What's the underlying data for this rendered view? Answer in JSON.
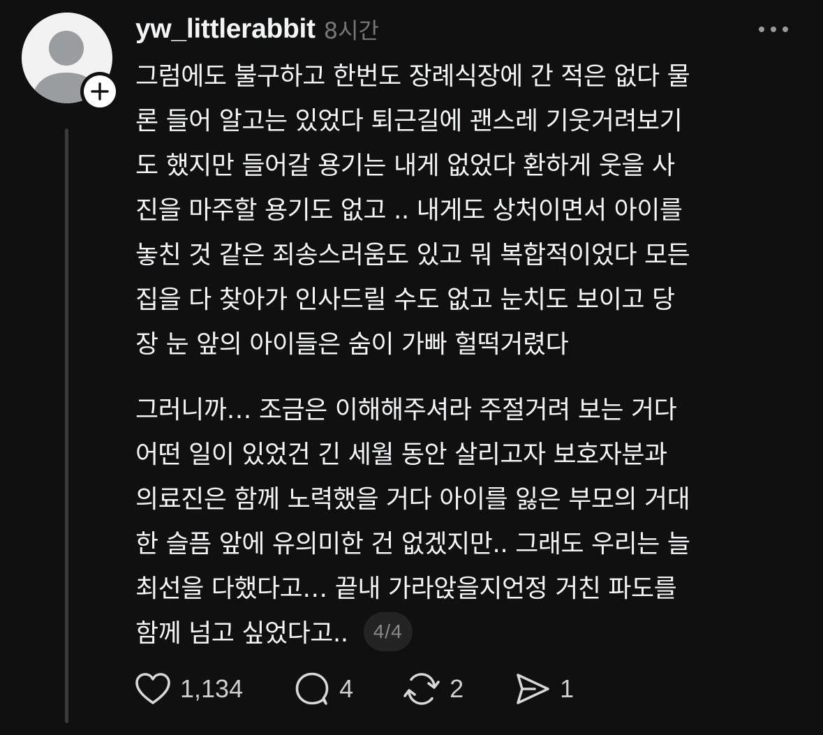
{
  "post": {
    "username": "yw_littlerabbit",
    "timestamp": "8시간",
    "page_indicator": "4/4",
    "paragraphs": [
      {
        "lines": [
          "그럼에도 불구하고 한번도 장례식장에 간 적은 없다 물",
          "론 들어 알고는 있었다 퇴근길에 괜스레 기웃거려보기",
          "도 했지만 들어갈 용기는 내게 없었다 환하게 웃을 사",
          "진을 마주할 용기도 없고 .. 내게도 상처이면서 아이를",
          "놓친 것 같은 죄송스러움도 있고 뭐 복합적이었다 모든",
          "집을 다 찾아가 인사드릴 수도 없고 눈치도 보이고 당",
          "장 눈 앞의 아이들은 숨이 가빠 헐떡거렸다"
        ]
      },
      {
        "lines": [
          "그러니까… 조금은 이해해주셔라 주절거려 보는 거다",
          "어떤 일이 있었건 긴 세월 동안 살리고자 보호자분과",
          "의료진은 함께 노력했을 거다 아이를 잃은 부모의 거대",
          "한 슬픔 앞에 유의미한 건 없겠지만.. 그래도 우리는 늘",
          "최선을 다했다고… 끝내 가라앉을지언정 거친 파도를",
          "함께 넘고 싶었다고.."
        ]
      }
    ]
  },
  "actions": {
    "like": {
      "icon": "heart-icon",
      "count": "1,134"
    },
    "reply": {
      "icon": "comment-icon",
      "count": "4"
    },
    "repost": {
      "icon": "repost-icon",
      "count": "2"
    },
    "share": {
      "icon": "send-icon",
      "count": "1"
    }
  },
  "icons": {
    "more": "more-horizontal-icon",
    "follow": "plus-icon",
    "avatar": "default-avatar-icon"
  },
  "colors": {
    "background": "#101010",
    "text_primary": "#f3f5f7",
    "text_secondary": "#777777",
    "thread_line": "#3a3a3a"
  }
}
